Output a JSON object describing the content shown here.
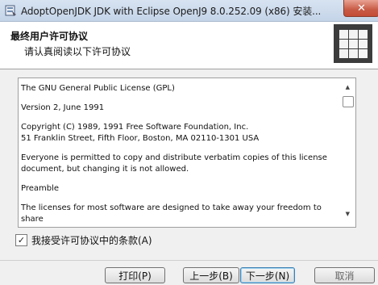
{
  "window": {
    "title": "AdoptOpenJDK JDK with Eclipse OpenJ9 8.0.252.09 (x86) 安装...",
    "close_label": "✕"
  },
  "banner": {
    "title": "最终用户许可协议",
    "subtitle": "请认真阅读以下许可协议"
  },
  "license": {
    "paragraphs": [
      "The GNU General Public License (GPL)",
      "Version 2, June 1991",
      "Copyright (C) 1989, 1991 Free Software Foundation, Inc.\n51 Franklin Street, Fifth Floor, Boston, MA 02110-1301 USA",
      "Everyone is permitted to copy and distribute verbatim copies of this license\ndocument, but changing it is not allowed.",
      "Preamble",
      "The licenses for most software are designed to take away your freedom to share"
    ]
  },
  "accept": {
    "label": "我接受许可协议中的条款(A)",
    "checked": true,
    "check_mark": "✓"
  },
  "buttons": {
    "print": "打印(P)",
    "back": "上一步(B)",
    "next": "下一步(N)",
    "cancel": "取消"
  },
  "scroll": {
    "up_arrow": "▲",
    "down_arrow": "▼"
  },
  "icons": {
    "app": "installer-icon",
    "logo": "grid-logo-icon"
  }
}
